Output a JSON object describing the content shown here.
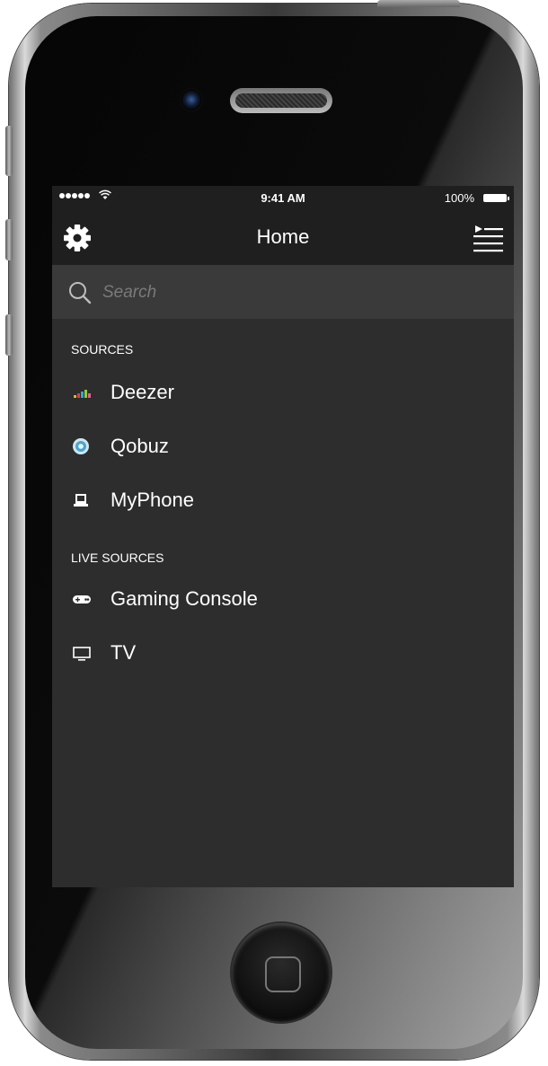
{
  "status_bar": {
    "time": "9:41 AM",
    "battery": "100%",
    "signal_dots": 5,
    "icons": [
      "signal-dots-icon",
      "wifi-icon",
      "battery-icon"
    ]
  },
  "nav": {
    "title": "Home",
    "left_icon": "gear-icon",
    "right_icon": "queue-list-icon"
  },
  "search": {
    "placeholder": "Search",
    "value": "",
    "icon": "search-icon"
  },
  "sections": [
    {
      "header": "SOURCES",
      "items": [
        {
          "label": "Deezer",
          "icon": "deezer-icon"
        },
        {
          "label": "Qobuz",
          "icon": "qobuz-icon"
        },
        {
          "label": "MyPhone",
          "icon": "phone-device-icon"
        }
      ]
    },
    {
      "header": "LIVE SOURCES",
      "items": [
        {
          "label": "Gaming Console",
          "icon": "gamepad-icon"
        },
        {
          "label": "TV",
          "icon": "tv-icon"
        }
      ]
    }
  ],
  "colors": {
    "screen_bg": "#2d2d2d",
    "bar_bg": "#1f1f1f",
    "search_bg": "#3a3a3a",
    "text": "#ffffff",
    "placeholder": "#7a7a7a"
  }
}
